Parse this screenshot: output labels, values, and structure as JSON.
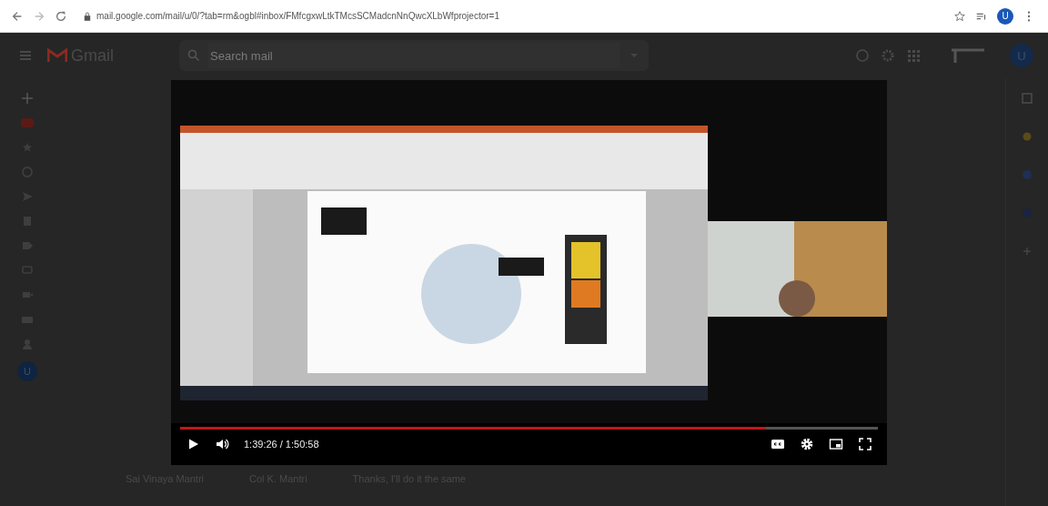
{
  "browser": {
    "url": "mail.google.com/mail/u/0/?tab=rm&ogbl#inbox/FMfcgxwLtkTMcsSCMadcnNnQwcXLbWfprojector=1",
    "avatar": "U"
  },
  "gmail": {
    "app_name": "Gmail",
    "search": {
      "placeholder": "Search mail"
    },
    "avatar": "U",
    "rail_avatar": "U",
    "footer_items": [
      "Sai Vinaya Mantri",
      "Col K. Mantri",
      "Thanks, I'll do it the same"
    ]
  },
  "video": {
    "kind": "picture",
    "playing": false,
    "level": 0.84,
    "time": "1:39:26 / 1:50:58"
  }
}
